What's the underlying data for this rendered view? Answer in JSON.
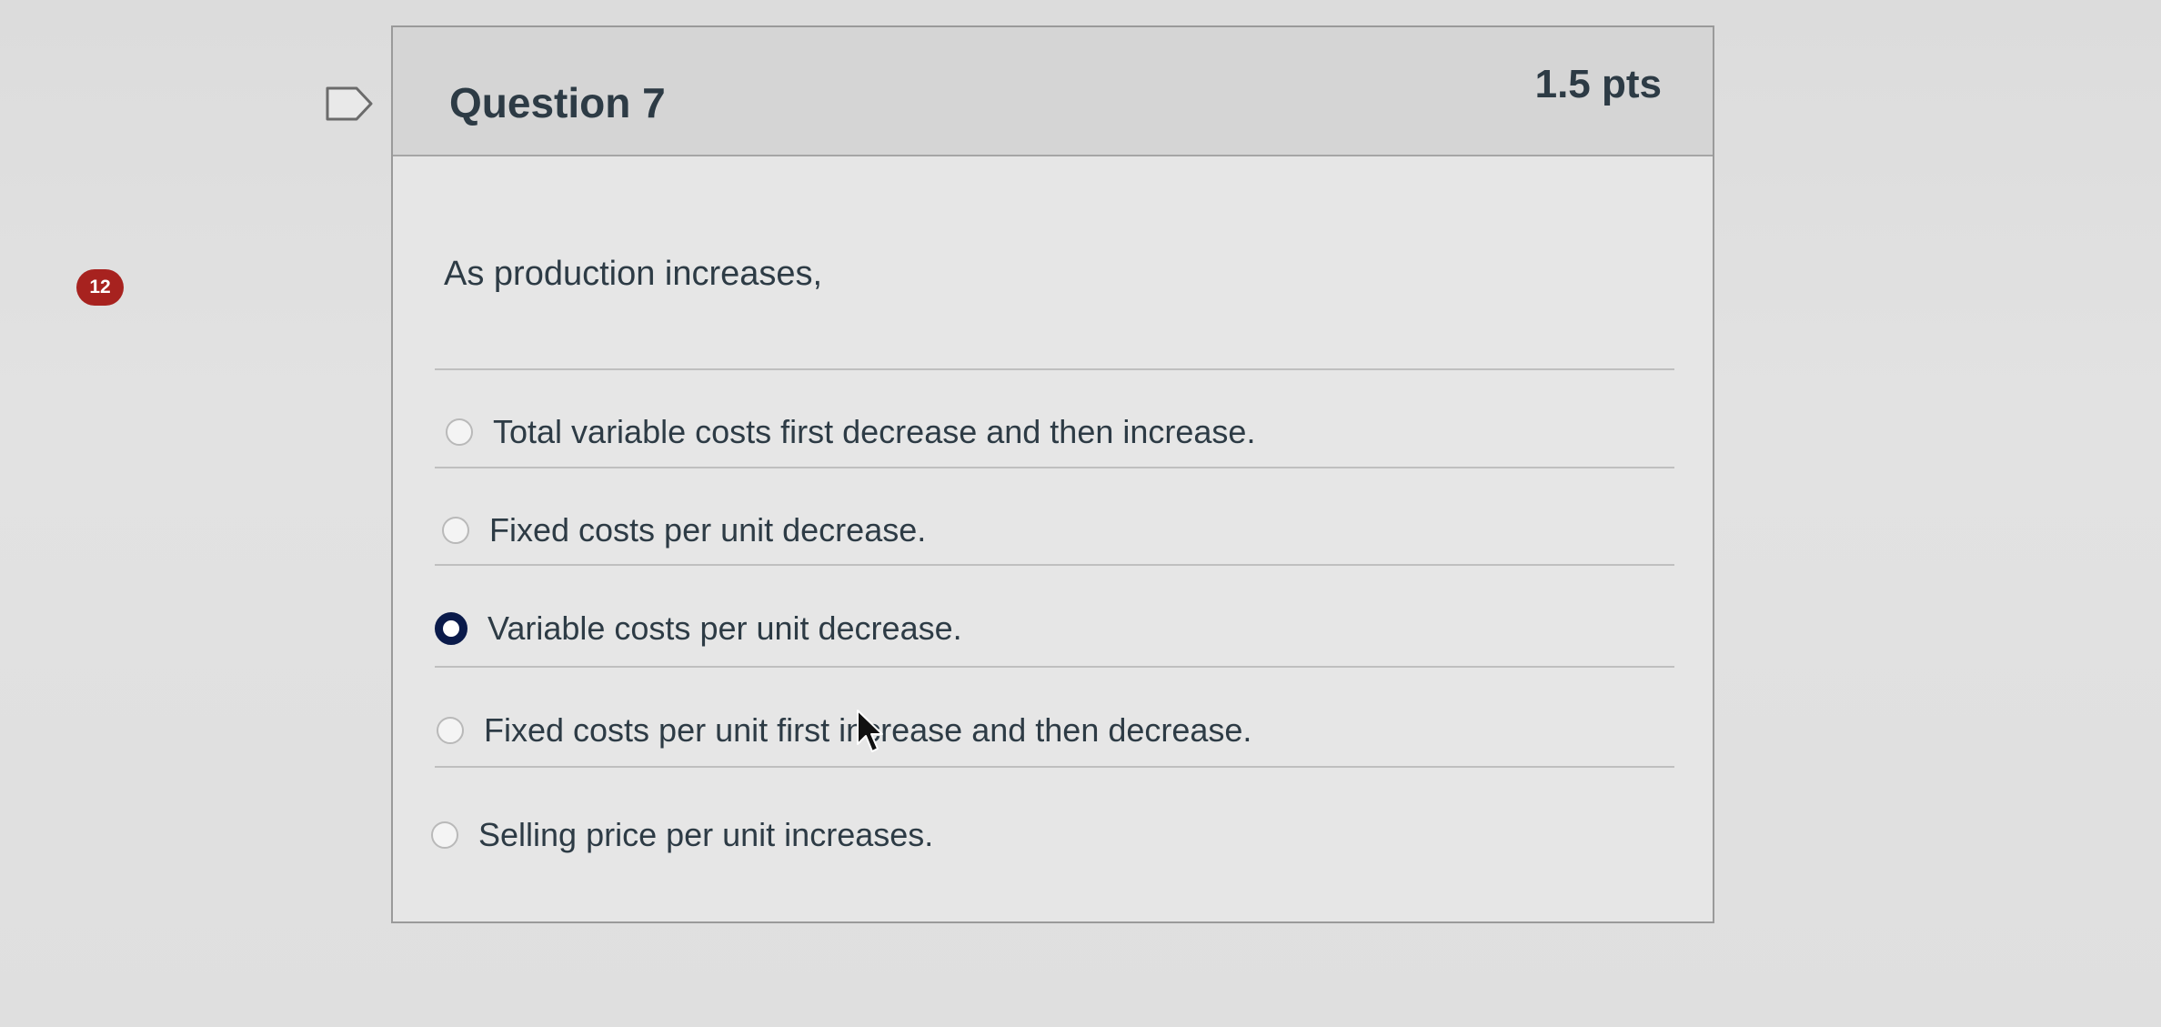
{
  "sidebar": {
    "badge_count": "12"
  },
  "question": {
    "title": "Question 7",
    "points": "1.5 pts",
    "text": "As production increases,",
    "answers": [
      {
        "label": "Total variable costs first decrease and then increase.",
        "selected": false
      },
      {
        "label": "Fixed costs per unit decrease.",
        "selected": false
      },
      {
        "label": "Variable costs per unit decrease.",
        "selected": true
      },
      {
        "label": "Fixed costs per unit first increase and then decrease.",
        "selected": false
      },
      {
        "label": "Selling price per unit increases.",
        "selected": false
      }
    ]
  },
  "icons": {
    "flag": "flag-icon",
    "cursor": "mouse-pointer-icon"
  },
  "colors": {
    "badge": "#a7221f",
    "selected_radio": "#0a1a4a",
    "text": "#2d3b45"
  }
}
